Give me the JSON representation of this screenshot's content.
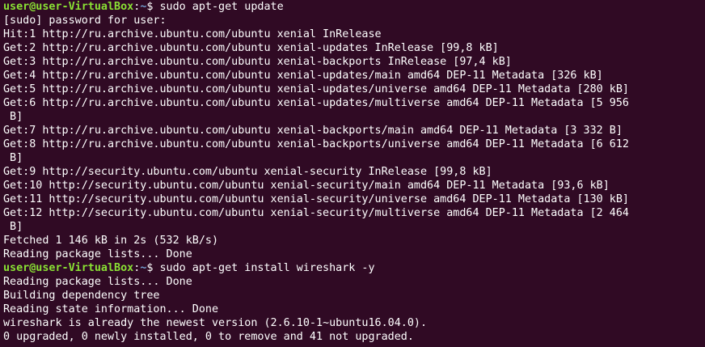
{
  "colors": {
    "background": "#300a24",
    "text": "#ffffff",
    "prompt_user": "#8ae234",
    "prompt_path": "#729fcf"
  },
  "terminal": {
    "lines": [
      {
        "type": "prompt",
        "user_host": "user@user-VirtualBox",
        "path": "~",
        "symbol": "$",
        "command": " sudo apt-get update"
      },
      {
        "type": "output",
        "text": "[sudo] password for user:"
      },
      {
        "type": "output",
        "text": "Hit:1 http://ru.archive.ubuntu.com/ubuntu xenial InRelease"
      },
      {
        "type": "output",
        "text": "Get:2 http://ru.archive.ubuntu.com/ubuntu xenial-updates InRelease [99,8 kB]"
      },
      {
        "type": "output",
        "text": "Get:3 http://ru.archive.ubuntu.com/ubuntu xenial-backports InRelease [97,4 kB]"
      },
      {
        "type": "output",
        "text": "Get:4 http://ru.archive.ubuntu.com/ubuntu xenial-updates/main amd64 DEP-11 Metadata [326 kB]"
      },
      {
        "type": "output",
        "text": "Get:5 http://ru.archive.ubuntu.com/ubuntu xenial-updates/universe amd64 DEP-11 Metadata [280 kB]"
      },
      {
        "type": "output",
        "text": "Get:6 http://ru.archive.ubuntu.com/ubuntu xenial-updates/multiverse amd64 DEP-11 Metadata [5 956"
      },
      {
        "type": "output",
        "text": " B]"
      },
      {
        "type": "output",
        "text": "Get:7 http://ru.archive.ubuntu.com/ubuntu xenial-backports/main amd64 DEP-11 Metadata [3 332 B]"
      },
      {
        "type": "output",
        "text": "Get:8 http://ru.archive.ubuntu.com/ubuntu xenial-backports/universe amd64 DEP-11 Metadata [6 612"
      },
      {
        "type": "output",
        "text": " B]"
      },
      {
        "type": "output",
        "text": "Get:9 http://security.ubuntu.com/ubuntu xenial-security InRelease [99,8 kB]"
      },
      {
        "type": "output",
        "text": "Get:10 http://security.ubuntu.com/ubuntu xenial-security/main amd64 DEP-11 Metadata [93,6 kB]"
      },
      {
        "type": "output",
        "text": "Get:11 http://security.ubuntu.com/ubuntu xenial-security/universe amd64 DEP-11 Metadata [130 kB]"
      },
      {
        "type": "output",
        "text": "Get:12 http://security.ubuntu.com/ubuntu xenial-security/multiverse amd64 DEP-11 Metadata [2 464"
      },
      {
        "type": "output",
        "text": " B]"
      },
      {
        "type": "output",
        "text": "Fetched 1 146 kB in 2s (532 kB/s)"
      },
      {
        "type": "output",
        "text": "Reading package lists... Done"
      },
      {
        "type": "prompt",
        "user_host": "user@user-VirtualBox",
        "path": "~",
        "symbol": "$",
        "command": " sudo apt-get install wireshark -y"
      },
      {
        "type": "output",
        "text": "Reading package lists... Done"
      },
      {
        "type": "output",
        "text": "Building dependency tree"
      },
      {
        "type": "output",
        "text": "Reading state information... Done"
      },
      {
        "type": "output",
        "text": "wireshark is already the newest version (2.6.10-1~ubuntu16.04.0)."
      },
      {
        "type": "output",
        "text": "0 upgraded, 0 newly installed, 0 to remove and 41 not upgraded."
      }
    ]
  }
}
